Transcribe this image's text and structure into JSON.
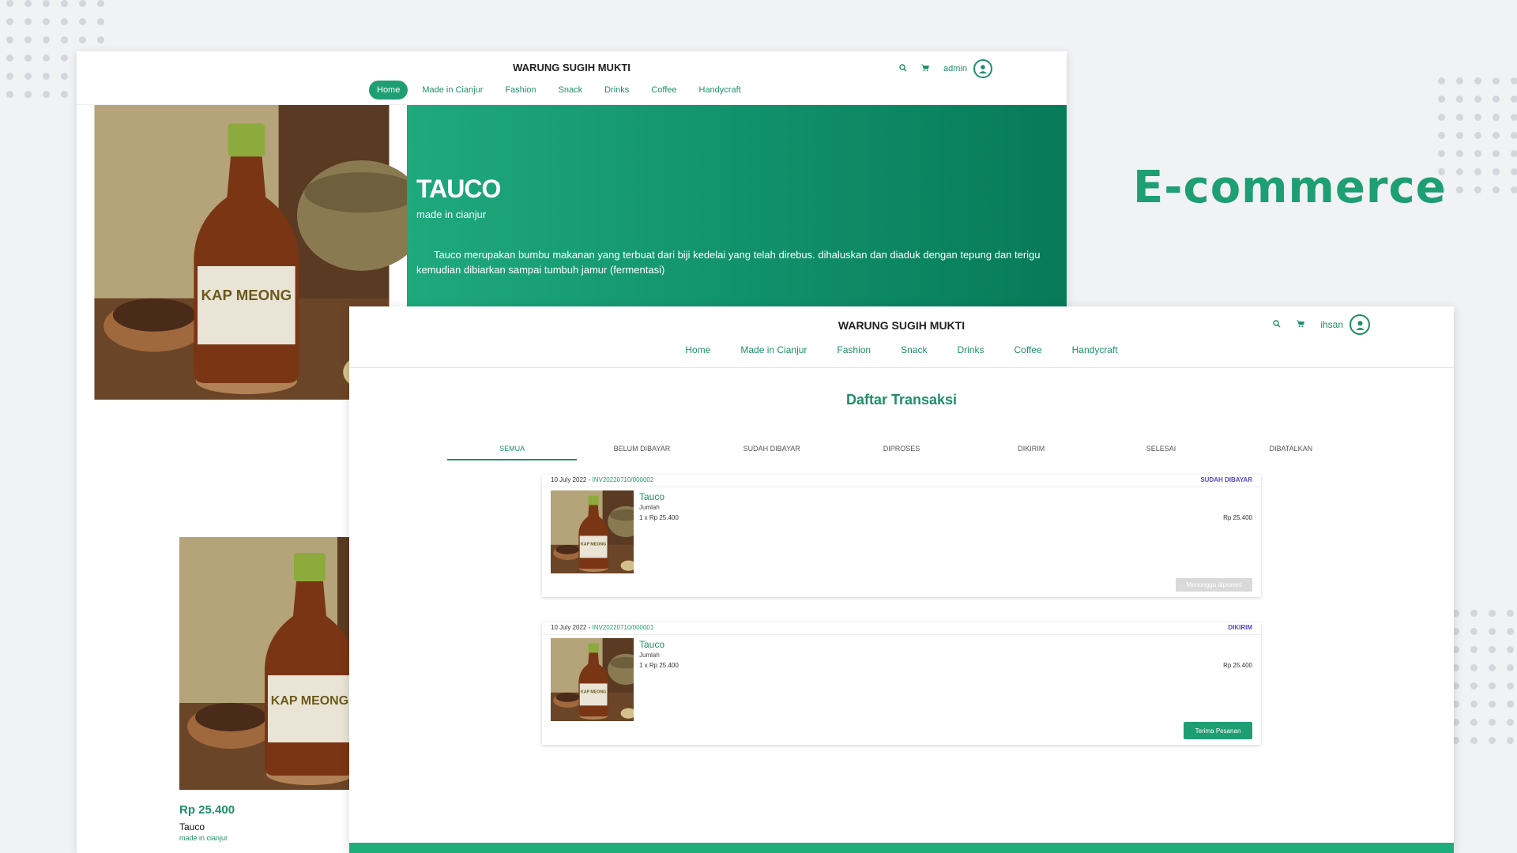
{
  "heading": "E-commerce",
  "colors": {
    "accent": "#1e9e73",
    "status_purple": "#5b47c7",
    "background": "#f1f2f4"
  },
  "shot1": {
    "brand": "WARUNG SUGIH MUKTI",
    "user": "admin",
    "icons": [
      "search-icon",
      "cart-icon",
      "user-icon"
    ],
    "nav": [
      {
        "label": "Home",
        "active": true
      },
      {
        "label": "Made in Cianjur"
      },
      {
        "label": "Fashion"
      },
      {
        "label": "Snack"
      },
      {
        "label": "Drinks"
      },
      {
        "label": "Coffee"
      },
      {
        "label": "Handycraft"
      }
    ],
    "hero": {
      "title": "TAUCO",
      "subtitle": "made in cianjur",
      "description": "Tauco merupakan bumbu makanan yang terbuat dari biji kedelai yang telah direbus. dihaluskan dan diaduk dengan tepung dan terigu kemudian dibiarkan sampai tumbuh jamur (fermentasi)"
    },
    "product": {
      "price": "Rp 25.400",
      "name": "Tauco",
      "origin": "made in cianjur"
    }
  },
  "shot2": {
    "brand": "WARUNG SUGIH MUKTI",
    "user": "ihsan",
    "icons": [
      "search-icon",
      "cart-icon",
      "user-icon"
    ],
    "nav": [
      "Home",
      "Made in Cianjur",
      "Fashion",
      "Snack",
      "Drinks",
      "Coffee",
      "Handycraft"
    ],
    "title": "Daftar Transaksi",
    "status_tabs": [
      {
        "label": "SEMUA",
        "active": true
      },
      {
        "label": "BELUM DIBAYAR"
      },
      {
        "label": "SUDAH DIBAYAR"
      },
      {
        "label": "DIPROSES"
      },
      {
        "label": "DIKIRIM"
      },
      {
        "label": "SELESAI"
      },
      {
        "label": "DIBATALKAN"
      }
    ],
    "orders": [
      {
        "date": "10 July 2022 - ",
        "invoice": "INV20220710/000002",
        "status": "SUDAH DIBAYAR",
        "name": "Tauco",
        "qty_label": "Jumlah",
        "qty": "1 x Rp 25.400",
        "total": "Rp 25.400",
        "action": "Menunggu diproses"
      },
      {
        "date": "10 July 2022 - ",
        "invoice": "INV20220710/000001",
        "status": "DIKIRIM",
        "name": "Tauco",
        "qty_label": "Jumlah",
        "qty": "1 x Rp 25.400",
        "total": "Rp 25.400",
        "action": "Terima Pesanan"
      }
    ]
  }
}
